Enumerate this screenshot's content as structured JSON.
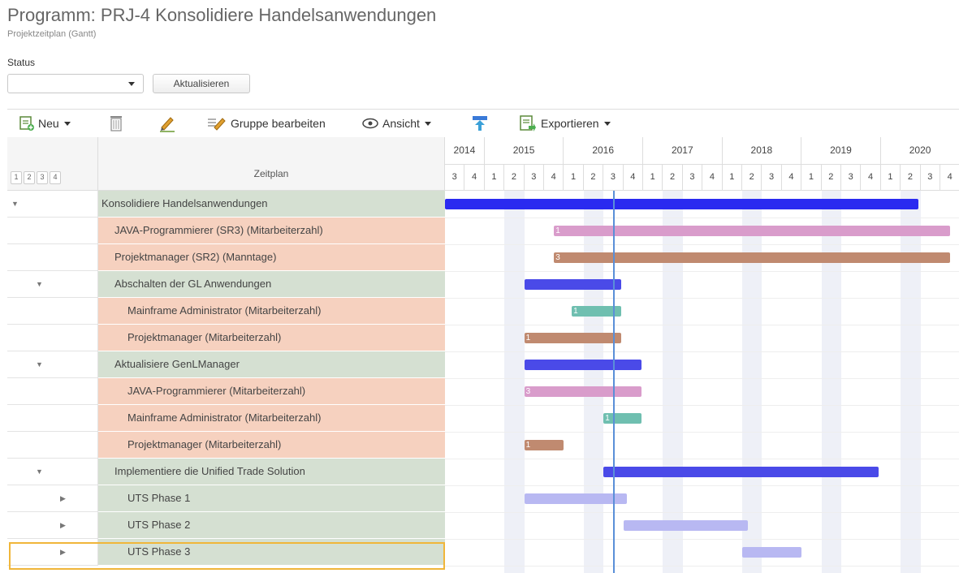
{
  "header": {
    "title": "Programm: PRJ-4 Konsolidiere Handelsanwendungen",
    "subtitle": "Projektzeitplan (Gantt)"
  },
  "filter": {
    "status_label": "Status",
    "status_value": "",
    "refresh_label": "Aktualisieren"
  },
  "toolbar": {
    "new_label": "Neu",
    "group_edit_label": "Gruppe bearbeiten",
    "view_label": "Ansicht",
    "export_label": "Exportieren"
  },
  "grid": {
    "name_header": "Zeitplan",
    "levels": [
      "1",
      "2",
      "3",
      "4"
    ],
    "years": [
      "2014",
      "2015",
      "2016",
      "2017",
      "2018",
      "2019",
      "2020"
    ],
    "quarters": [
      "3",
      "4",
      "1",
      "2",
      "3",
      "4",
      "1",
      "2",
      "3",
      "4",
      "1",
      "2",
      "3",
      "4",
      "1",
      "2",
      "3",
      "4",
      "1",
      "2",
      "3",
      "4",
      "1",
      "2",
      "3",
      "4"
    ]
  },
  "rows": [
    {
      "name": "Konsolidiere Handelsanwendungen",
      "kind": "task",
      "indent": 0,
      "toggle": "expanded"
    },
    {
      "name": "JAVA-Programmierer (SR3) (Mitarbeiterzahl)",
      "kind": "resource",
      "indent": 1,
      "toggle": "none"
    },
    {
      "name": "Projektmanager (SR2) (Manntage)",
      "kind": "resource",
      "indent": 1,
      "toggle": "none"
    },
    {
      "name": "Abschalten der GL Anwendungen",
      "kind": "task",
      "indent": 1,
      "toggle": "expanded"
    },
    {
      "name": "Mainframe Administrator (Mitarbeiterzahl)",
      "kind": "resource",
      "indent": 2,
      "toggle": "none"
    },
    {
      "name": "Projektmanager (Mitarbeiterzahl)",
      "kind": "resource",
      "indent": 2,
      "toggle": "none"
    },
    {
      "name": "Aktualisiere GenLManager",
      "kind": "task",
      "indent": 1,
      "toggle": "expanded"
    },
    {
      "name": "JAVA-Programmierer (Mitarbeiterzahl)",
      "kind": "resource",
      "indent": 2,
      "toggle": "none"
    },
    {
      "name": "Mainframe Administrator (Mitarbeiterzahl)",
      "kind": "resource",
      "indent": 2,
      "toggle": "none"
    },
    {
      "name": "Projektmanager (Mitarbeiterzahl)",
      "kind": "resource",
      "indent": 2,
      "toggle": "none"
    },
    {
      "name": "Implementiere die Unified Trade Solution",
      "kind": "task",
      "indent": 1,
      "toggle": "expanded"
    },
    {
      "name": "UTS Phase 1",
      "kind": "task",
      "indent": 2,
      "toggle": "collapsed"
    },
    {
      "name": "UTS Phase 2",
      "kind": "task",
      "indent": 2,
      "toggle": "collapsed"
    },
    {
      "name": "UTS Phase 3",
      "kind": "task",
      "indent": 2,
      "toggle": "collapsed",
      "selected": true
    }
  ],
  "bars": [
    {
      "row": 0,
      "start": 0.0,
      "end": 23.9,
      "color": "#2a2af0",
      "label": ""
    },
    {
      "row": 1,
      "start": 5.5,
      "end": 25.5,
      "color": "#d99ccb",
      "label": "1"
    },
    {
      "row": 2,
      "start": 5.5,
      "end": 25.5,
      "color": "#c08a70",
      "label": "3"
    },
    {
      "row": 3,
      "start": 4.0,
      "end": 8.9,
      "color": "#4a4ae8",
      "label": ""
    },
    {
      "row": 4,
      "start": 6.4,
      "end": 8.9,
      "color": "#6fbfb0",
      "label": "1"
    },
    {
      "row": 5,
      "start": 4.0,
      "end": 8.9,
      "color": "#c08a70",
      "label": "1"
    },
    {
      "row": 6,
      "start": 4.0,
      "end": 9.9,
      "color": "#4a4ae8",
      "label": ""
    },
    {
      "row": 7,
      "start": 4.0,
      "end": 9.9,
      "color": "#d99ccb",
      "label": "3"
    },
    {
      "row": 8,
      "start": 8.0,
      "end": 9.9,
      "color": "#6fbfb0",
      "label": "1"
    },
    {
      "row": 9,
      "start": 4.0,
      "end": 6.0,
      "color": "#c08a70",
      "label": "1"
    },
    {
      "row": 10,
      "start": 8.0,
      "end": 21.9,
      "color": "#4a4ae8",
      "label": ""
    },
    {
      "row": 11,
      "start": 4.0,
      "end": 9.2,
      "color": "#b8b8f2",
      "label": ""
    },
    {
      "row": 12,
      "start": 9.0,
      "end": 15.3,
      "color": "#b8b8f2",
      "label": ""
    },
    {
      "row": 13,
      "start": 15.0,
      "end": 18.0,
      "color": "#b8b8f2",
      "label": ""
    }
  ],
  "today_quarter": 8.5
}
